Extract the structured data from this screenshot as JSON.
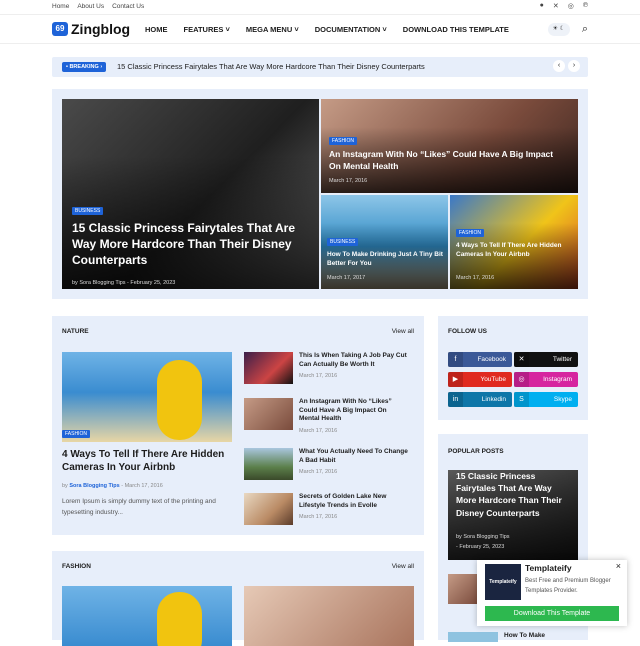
{
  "topbar": {
    "links": [
      "Home",
      "About Us",
      "Contact Us"
    ],
    "social": [
      "facebook-icon",
      "x-icon",
      "instagram-icon",
      "pinterest-icon"
    ]
  },
  "header": {
    "logo_mark": "69",
    "logo_text": "Zingblog",
    "nav": [
      "HOME",
      "FEATURES",
      "MEGA MENU",
      "DOCUMENTATION",
      "DOWNLOAD THIS TEMPLATE"
    ],
    "toggle_label": "☀ ☾"
  },
  "breaking": {
    "tag": "• BREAKING ›",
    "text": "15 Classic Princess Fairytales That Are Way More Hardcore Than Their Disney Counterparts"
  },
  "hero": {
    "main": {
      "badge": "BUSINESS",
      "title": "15 Classic Princess Fairytales That Are Way More Hardcore Than Their Disney Counterparts",
      "meta": "by Sora Blogging Tips - February 25, 2023"
    },
    "top_right": {
      "badge": "FASHION",
      "title": "An Instagram With No “Likes” Could Have A Big Impact On Mental Health",
      "meta": "March 17, 2016"
    },
    "bottom_left": {
      "badge": "BUSINESS",
      "title": "How To Make Drinking Just A Tiny Bit Better For You",
      "meta": "March 17, 2017"
    },
    "bottom_right": {
      "badge": "FASHION",
      "title": "4 Ways To Tell If There Are Hidden Cameras In Your Airbnb",
      "meta": "March 17, 2016"
    }
  },
  "nature": {
    "heading": "NATURE",
    "view_all": "View all",
    "feature": {
      "badge": "FASHION",
      "title": "4 Ways To Tell If There Are Hidden Cameras In Your Airbnb",
      "author": "Sora Blogging Tips",
      "date": "- March 17, 2016",
      "by": "by",
      "excerpt": "Lorem Ipsum is simply dummy text of the printing and typesetting industry..."
    },
    "items": [
      {
        "title": "This Is When Taking A Job Pay Cut Can Actually Be Worth It",
        "date": "March 17, 2016"
      },
      {
        "title": "An Instagram With No “Likes” Could Have A Big Impact On Mental Health",
        "date": "March 17, 2016"
      },
      {
        "title": "What You Actually Need To Change A Bad Habit",
        "date": "March 17, 2016"
      },
      {
        "title": "Secrets of Golden Lake New Lifestyle Trends in Evolle",
        "date": "March 17, 2016"
      }
    ]
  },
  "fashion": {
    "heading": "FASHION",
    "view_all": "View all"
  },
  "follow": {
    "heading": "FOLLOW US",
    "buttons": [
      {
        "label": "Facebook",
        "icon": "facebook-icon",
        "color": "#3b5998"
      },
      {
        "label": "Twitter",
        "icon": "x-icon",
        "color": "#111111"
      },
      {
        "label": "YouTube",
        "icon": "youtube-icon",
        "color": "#e02a20"
      },
      {
        "label": "Instagram",
        "icon": "instagram-icon",
        "color": "#d6249f"
      },
      {
        "label": "Linkedin",
        "icon": "linkedin-icon",
        "color": "#0e76a8"
      },
      {
        "label": "Skype",
        "icon": "skype-icon",
        "color": "#00aff0"
      }
    ]
  },
  "popular": {
    "heading": "POPULAR POSTS",
    "title": "15 Classic Princess Fairytales That Are Way More Hardcore Than Their Disney Counterparts",
    "by": "by Sora Blogging Tips",
    "date": "- February 25, 2023",
    "next_title": "How To Make"
  },
  "popup": {
    "thumb_text": "Templateify",
    "title": "Templateify",
    "desc": "Best Free and Premium Blogger Templates Provider.",
    "button": "Download This Template",
    "close": "×"
  },
  "colors": {
    "accent": "#1e63d8",
    "panel": "#e7eefa"
  }
}
